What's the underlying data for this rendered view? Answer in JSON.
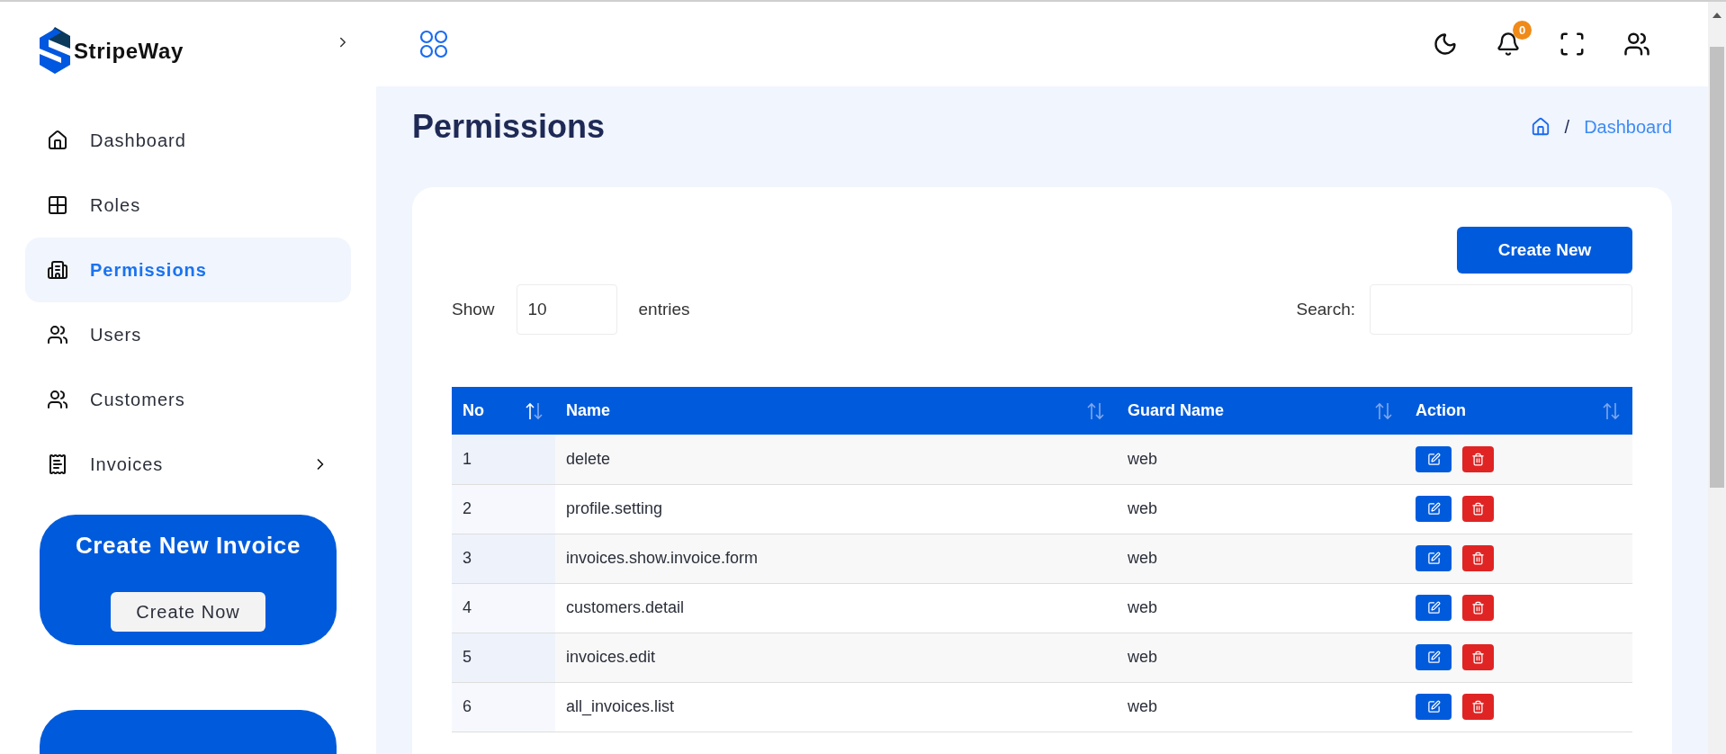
{
  "brand": {
    "name": "StripeWay"
  },
  "sidebar": {
    "items": [
      {
        "label": "Dashboard",
        "selected": false,
        "submenu": false
      },
      {
        "label": "Roles",
        "selected": false,
        "submenu": false
      },
      {
        "label": "Permissions",
        "selected": true,
        "submenu": false
      },
      {
        "label": "Users",
        "selected": false,
        "submenu": false
      },
      {
        "label": "Customers",
        "selected": false,
        "submenu": false
      },
      {
        "label": "Invoices",
        "selected": false,
        "submenu": true
      }
    ],
    "promo": {
      "title": "Create New Invoice",
      "button": "Create Now"
    }
  },
  "topbar": {
    "notifications": "0"
  },
  "page": {
    "title": "Permissions",
    "breadcrumb_separator": "/",
    "breadcrumb": "Dashboard"
  },
  "table_controls": {
    "create_button": "Create New",
    "show_label": "Show",
    "page_size": "10",
    "entries_label": "entries",
    "search_label": "Search:"
  },
  "table": {
    "columns": [
      {
        "label": "No",
        "sorted": true
      },
      {
        "label": "Name",
        "sorted": false
      },
      {
        "label": "Guard Name",
        "sorted": false
      },
      {
        "label": "Action",
        "sorted": false
      }
    ],
    "rows": [
      {
        "no": "1",
        "name": "delete",
        "guard": "web"
      },
      {
        "no": "2",
        "name": "profile.setting",
        "guard": "web"
      },
      {
        "no": "3",
        "name": "invoices.show.invoice.form",
        "guard": "web"
      },
      {
        "no": "4",
        "name": "customers.detail",
        "guard": "web"
      },
      {
        "no": "5",
        "name": "invoices.edit",
        "guard": "web"
      },
      {
        "no": "6",
        "name": "all_invoices.list",
        "guard": "web"
      }
    ]
  }
}
